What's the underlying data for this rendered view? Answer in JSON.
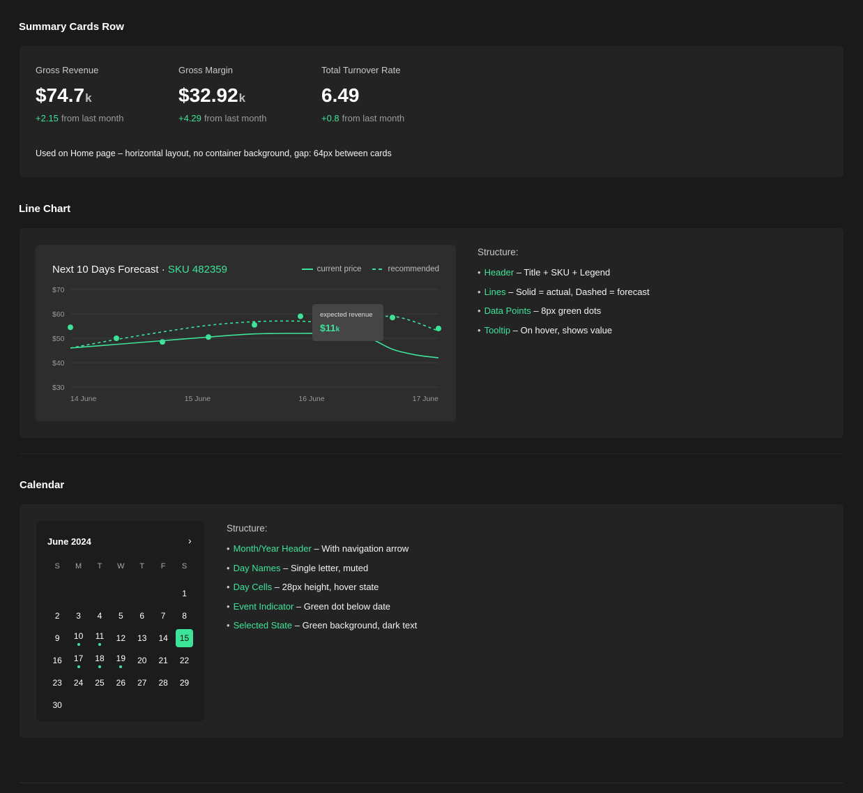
{
  "summary": {
    "title": "Summary Cards Row",
    "cards": [
      {
        "label": "Gross Revenue",
        "value": "$74.7",
        "unit": "k",
        "delta": "+2.15",
        "delta_text": "from last month"
      },
      {
        "label": "Gross Margin",
        "value": "$32.92",
        "unit": "k",
        "delta": "+4.29",
        "delta_text": "from last month"
      },
      {
        "label": "Total Turnover Rate",
        "value": "6.49",
        "unit": "",
        "delta": "+0.8",
        "delta_text": "from last month"
      }
    ],
    "note": "Used on Home page – horizontal layout, no container background, gap: 64px between cards"
  },
  "line_chart": {
    "section_title": "Line Chart",
    "card_title": "Next 10 Days Forecast",
    "separator": " · ",
    "sku": "SKU 482359",
    "legend": {
      "current": "current price",
      "recommended": "recommended"
    },
    "tooltip": {
      "label": "expected revenue",
      "value": "$11",
      "unit": "k"
    },
    "structure": {
      "heading": "Structure:",
      "items": [
        {
          "key": "Header",
          "desc": " – Title + SKU + Legend"
        },
        {
          "key": "Lines",
          "desc": " – Solid = actual, Dashed = forecast"
        },
        {
          "key": "Data Points",
          "desc": " – 8px green dots"
        },
        {
          "key": "Tooltip",
          "desc": " – On hover, shows value"
        }
      ]
    }
  },
  "chart_data": {
    "type": "line",
    "y_ticks": [
      "$70",
      "$60",
      "$50",
      "$40",
      "$30"
    ],
    "x_ticks": [
      "14 June",
      "15 June",
      "16 June",
      "17 June"
    ],
    "ylim": [
      30,
      70
    ],
    "xlim": [
      0,
      8
    ],
    "grid": true,
    "legend_position": "top-right",
    "series": [
      {
        "name": "current price",
        "style": "solid",
        "x": [
          0,
          1,
          2,
          3,
          4,
          5,
          6,
          6.5,
          7,
          7.5,
          8
        ],
        "y": [
          46,
          47.5,
          49,
          50.5,
          51.8,
          52,
          51.8,
          50,
          45.5,
          43.2,
          42
        ]
      },
      {
        "name": "recommended",
        "style": "dashed",
        "x": [
          0,
          1,
          2,
          3,
          4,
          5,
          6,
          7,
          8
        ],
        "y": [
          46,
          49.5,
          52.6,
          55.3,
          56.8,
          57,
          56,
          59,
          53
        ]
      }
    ],
    "points": [
      {
        "x": 0,
        "y": 54.5
      },
      {
        "x": 1,
        "y": 50
      },
      {
        "x": 2,
        "y": 48.5
      },
      {
        "x": 3,
        "y": 50.5
      },
      {
        "x": 4,
        "y": 55.5
      },
      {
        "x": 5,
        "y": 59
      },
      {
        "x": 7,
        "y": 58.5
      },
      {
        "x": 8,
        "y": 54
      }
    ],
    "colors": {
      "line": "#3ee39a",
      "grid": "#3a3a3a",
      "tick": "#9a9a9a"
    }
  },
  "calendar": {
    "section_title": "Calendar",
    "month_label": "June 2024",
    "next_icon": "chevron-right-icon",
    "next_glyph": "›",
    "day_names": [
      "S",
      "M",
      "T",
      "W",
      "T",
      "F",
      "S"
    ],
    "first_weekday": 6,
    "days": 30,
    "selected": 15,
    "events": [
      10,
      11,
      17,
      18,
      19
    ],
    "structure": {
      "heading": "Structure:",
      "items": [
        {
          "key": "Month/Year Header",
          "desc": " – With navigation arrow"
        },
        {
          "key": "Day Names",
          "desc": " – Single letter, muted"
        },
        {
          "key": "Day Cells",
          "desc": " – 28px height, hover state"
        },
        {
          "key": "Event Indicator",
          "desc": " – Green dot below date"
        },
        {
          "key": "Selected State",
          "desc": " – Green background, dark text"
        }
      ]
    }
  },
  "theme": {
    "accent": "#3ee39a",
    "background": "#1a1a1a",
    "panel": "#232323"
  }
}
